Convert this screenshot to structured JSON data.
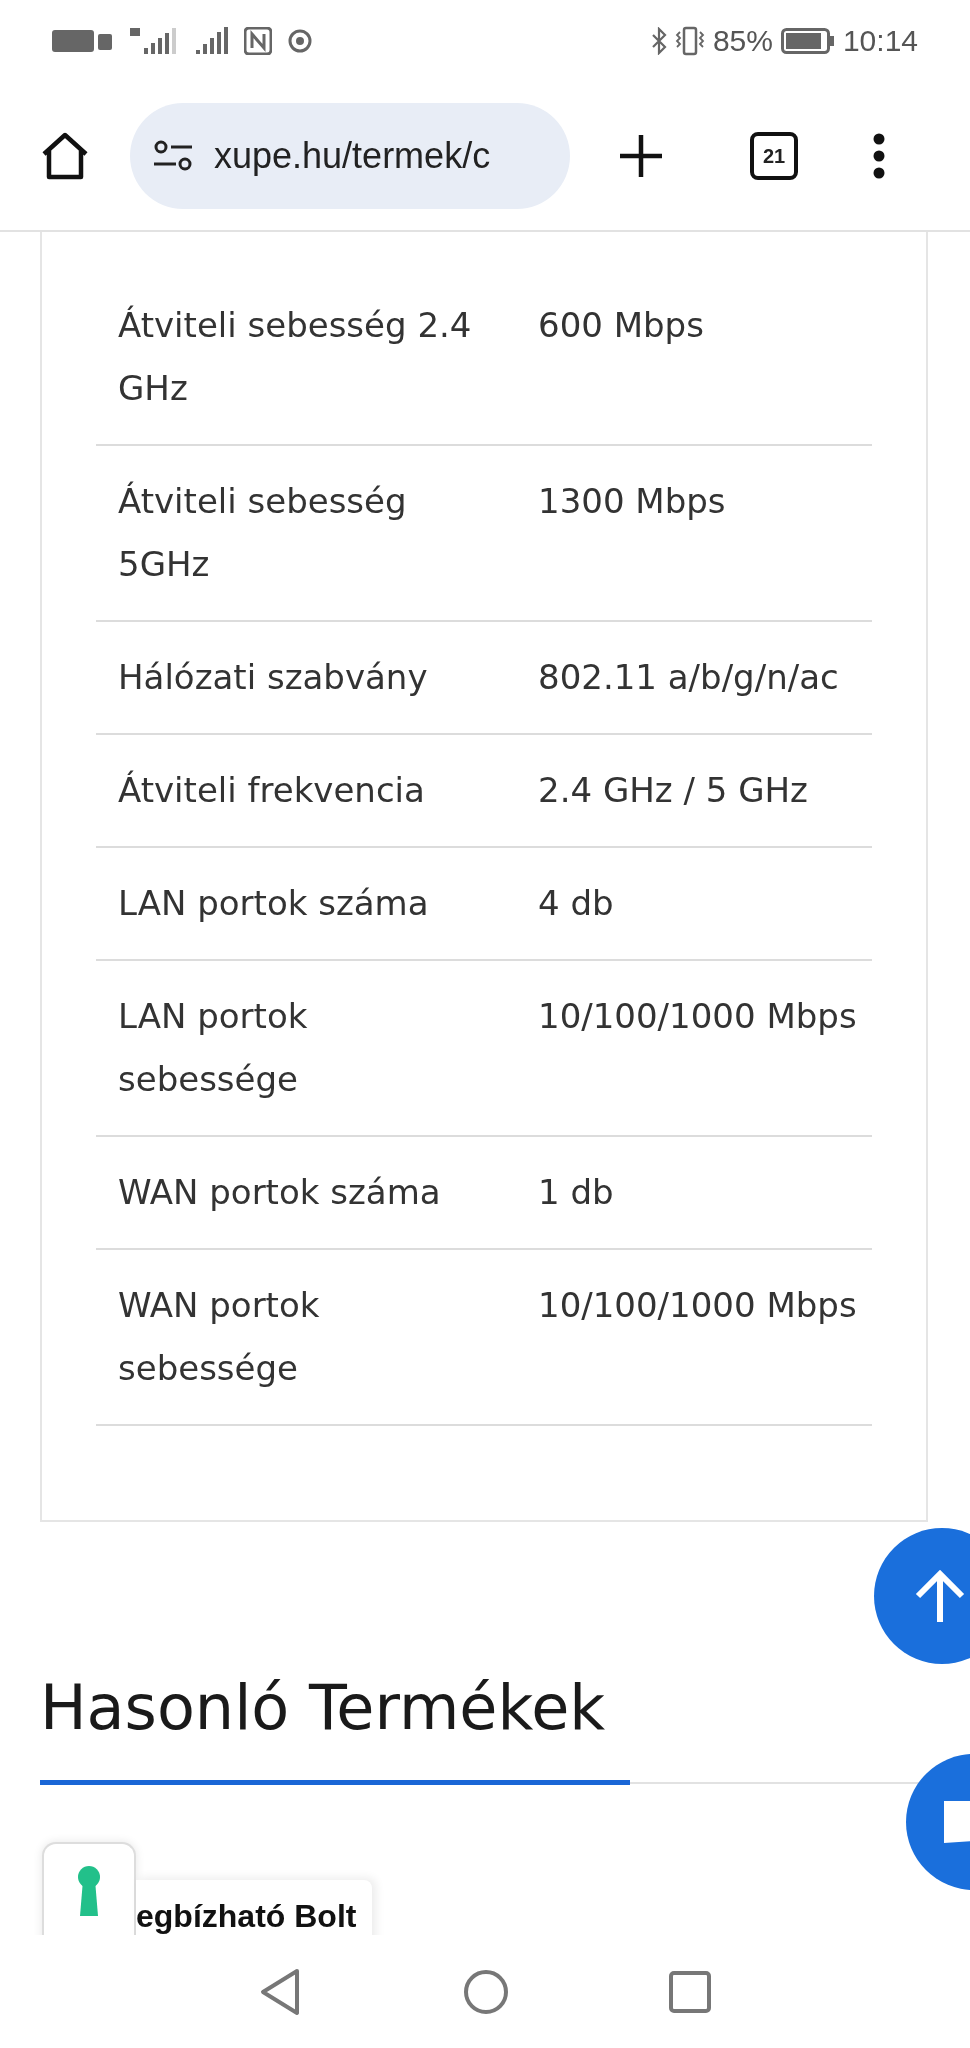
{
  "status_bar": {
    "battery": "85%",
    "time": "10:14"
  },
  "browser": {
    "url": "xupe.hu/termek/c",
    "tab_count": "21"
  },
  "specs": [
    {
      "label": "Átviteli sebesség 2.4 GHz",
      "value": "600 Mbps"
    },
    {
      "label": "Átviteli sebesség 5GHz",
      "value": "1300 Mbps"
    },
    {
      "label": "Hálózati szabvány",
      "value": "802.11 a/b/g/n/ac"
    },
    {
      "label": "Átviteli frekvencia",
      "value": "2.4 GHz / 5 GHz"
    },
    {
      "label": "LAN portok száma",
      "value": "4 db"
    },
    {
      "label": "LAN portok sebessége",
      "value": "10/100/1000 Mbps"
    },
    {
      "label": "WAN portok száma",
      "value": "1 db"
    },
    {
      "label": "WAN portok sebessége",
      "value": "10/100/1000 Mbps"
    }
  ],
  "section_title": "Hasonló Termékek",
  "trust_badge": {
    "text": "egbízható Bolt"
  }
}
